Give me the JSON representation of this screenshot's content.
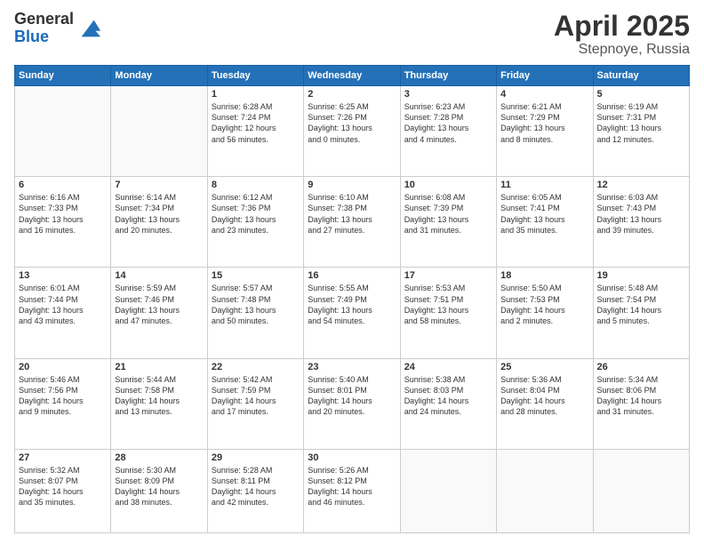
{
  "logo": {
    "general": "General",
    "blue": "Blue"
  },
  "title": "April 2025",
  "subtitle": "Stepnoye, Russia",
  "days_header": [
    "Sunday",
    "Monday",
    "Tuesday",
    "Wednesday",
    "Thursday",
    "Friday",
    "Saturday"
  ],
  "weeks": [
    [
      {
        "day": "",
        "info": ""
      },
      {
        "day": "",
        "info": ""
      },
      {
        "day": "1",
        "info": "Sunrise: 6:28 AM\nSunset: 7:24 PM\nDaylight: 12 hours\nand 56 minutes."
      },
      {
        "day": "2",
        "info": "Sunrise: 6:25 AM\nSunset: 7:26 PM\nDaylight: 13 hours\nand 0 minutes."
      },
      {
        "day": "3",
        "info": "Sunrise: 6:23 AM\nSunset: 7:28 PM\nDaylight: 13 hours\nand 4 minutes."
      },
      {
        "day": "4",
        "info": "Sunrise: 6:21 AM\nSunset: 7:29 PM\nDaylight: 13 hours\nand 8 minutes."
      },
      {
        "day": "5",
        "info": "Sunrise: 6:19 AM\nSunset: 7:31 PM\nDaylight: 13 hours\nand 12 minutes."
      }
    ],
    [
      {
        "day": "6",
        "info": "Sunrise: 6:16 AM\nSunset: 7:33 PM\nDaylight: 13 hours\nand 16 minutes."
      },
      {
        "day": "7",
        "info": "Sunrise: 6:14 AM\nSunset: 7:34 PM\nDaylight: 13 hours\nand 20 minutes."
      },
      {
        "day": "8",
        "info": "Sunrise: 6:12 AM\nSunset: 7:36 PM\nDaylight: 13 hours\nand 23 minutes."
      },
      {
        "day": "9",
        "info": "Sunrise: 6:10 AM\nSunset: 7:38 PM\nDaylight: 13 hours\nand 27 minutes."
      },
      {
        "day": "10",
        "info": "Sunrise: 6:08 AM\nSunset: 7:39 PM\nDaylight: 13 hours\nand 31 minutes."
      },
      {
        "day": "11",
        "info": "Sunrise: 6:05 AM\nSunset: 7:41 PM\nDaylight: 13 hours\nand 35 minutes."
      },
      {
        "day": "12",
        "info": "Sunrise: 6:03 AM\nSunset: 7:43 PM\nDaylight: 13 hours\nand 39 minutes."
      }
    ],
    [
      {
        "day": "13",
        "info": "Sunrise: 6:01 AM\nSunset: 7:44 PM\nDaylight: 13 hours\nand 43 minutes."
      },
      {
        "day": "14",
        "info": "Sunrise: 5:59 AM\nSunset: 7:46 PM\nDaylight: 13 hours\nand 47 minutes."
      },
      {
        "day": "15",
        "info": "Sunrise: 5:57 AM\nSunset: 7:48 PM\nDaylight: 13 hours\nand 50 minutes."
      },
      {
        "day": "16",
        "info": "Sunrise: 5:55 AM\nSunset: 7:49 PM\nDaylight: 13 hours\nand 54 minutes."
      },
      {
        "day": "17",
        "info": "Sunrise: 5:53 AM\nSunset: 7:51 PM\nDaylight: 13 hours\nand 58 minutes."
      },
      {
        "day": "18",
        "info": "Sunrise: 5:50 AM\nSunset: 7:53 PM\nDaylight: 14 hours\nand 2 minutes."
      },
      {
        "day": "19",
        "info": "Sunrise: 5:48 AM\nSunset: 7:54 PM\nDaylight: 14 hours\nand 5 minutes."
      }
    ],
    [
      {
        "day": "20",
        "info": "Sunrise: 5:46 AM\nSunset: 7:56 PM\nDaylight: 14 hours\nand 9 minutes."
      },
      {
        "day": "21",
        "info": "Sunrise: 5:44 AM\nSunset: 7:58 PM\nDaylight: 14 hours\nand 13 minutes."
      },
      {
        "day": "22",
        "info": "Sunrise: 5:42 AM\nSunset: 7:59 PM\nDaylight: 14 hours\nand 17 minutes."
      },
      {
        "day": "23",
        "info": "Sunrise: 5:40 AM\nSunset: 8:01 PM\nDaylight: 14 hours\nand 20 minutes."
      },
      {
        "day": "24",
        "info": "Sunrise: 5:38 AM\nSunset: 8:03 PM\nDaylight: 14 hours\nand 24 minutes."
      },
      {
        "day": "25",
        "info": "Sunrise: 5:36 AM\nSunset: 8:04 PM\nDaylight: 14 hours\nand 28 minutes."
      },
      {
        "day": "26",
        "info": "Sunrise: 5:34 AM\nSunset: 8:06 PM\nDaylight: 14 hours\nand 31 minutes."
      }
    ],
    [
      {
        "day": "27",
        "info": "Sunrise: 5:32 AM\nSunset: 8:07 PM\nDaylight: 14 hours\nand 35 minutes."
      },
      {
        "day": "28",
        "info": "Sunrise: 5:30 AM\nSunset: 8:09 PM\nDaylight: 14 hours\nand 38 minutes."
      },
      {
        "day": "29",
        "info": "Sunrise: 5:28 AM\nSunset: 8:11 PM\nDaylight: 14 hours\nand 42 minutes."
      },
      {
        "day": "30",
        "info": "Sunrise: 5:26 AM\nSunset: 8:12 PM\nDaylight: 14 hours\nand 46 minutes."
      },
      {
        "day": "",
        "info": ""
      },
      {
        "day": "",
        "info": ""
      },
      {
        "day": "",
        "info": ""
      }
    ]
  ]
}
